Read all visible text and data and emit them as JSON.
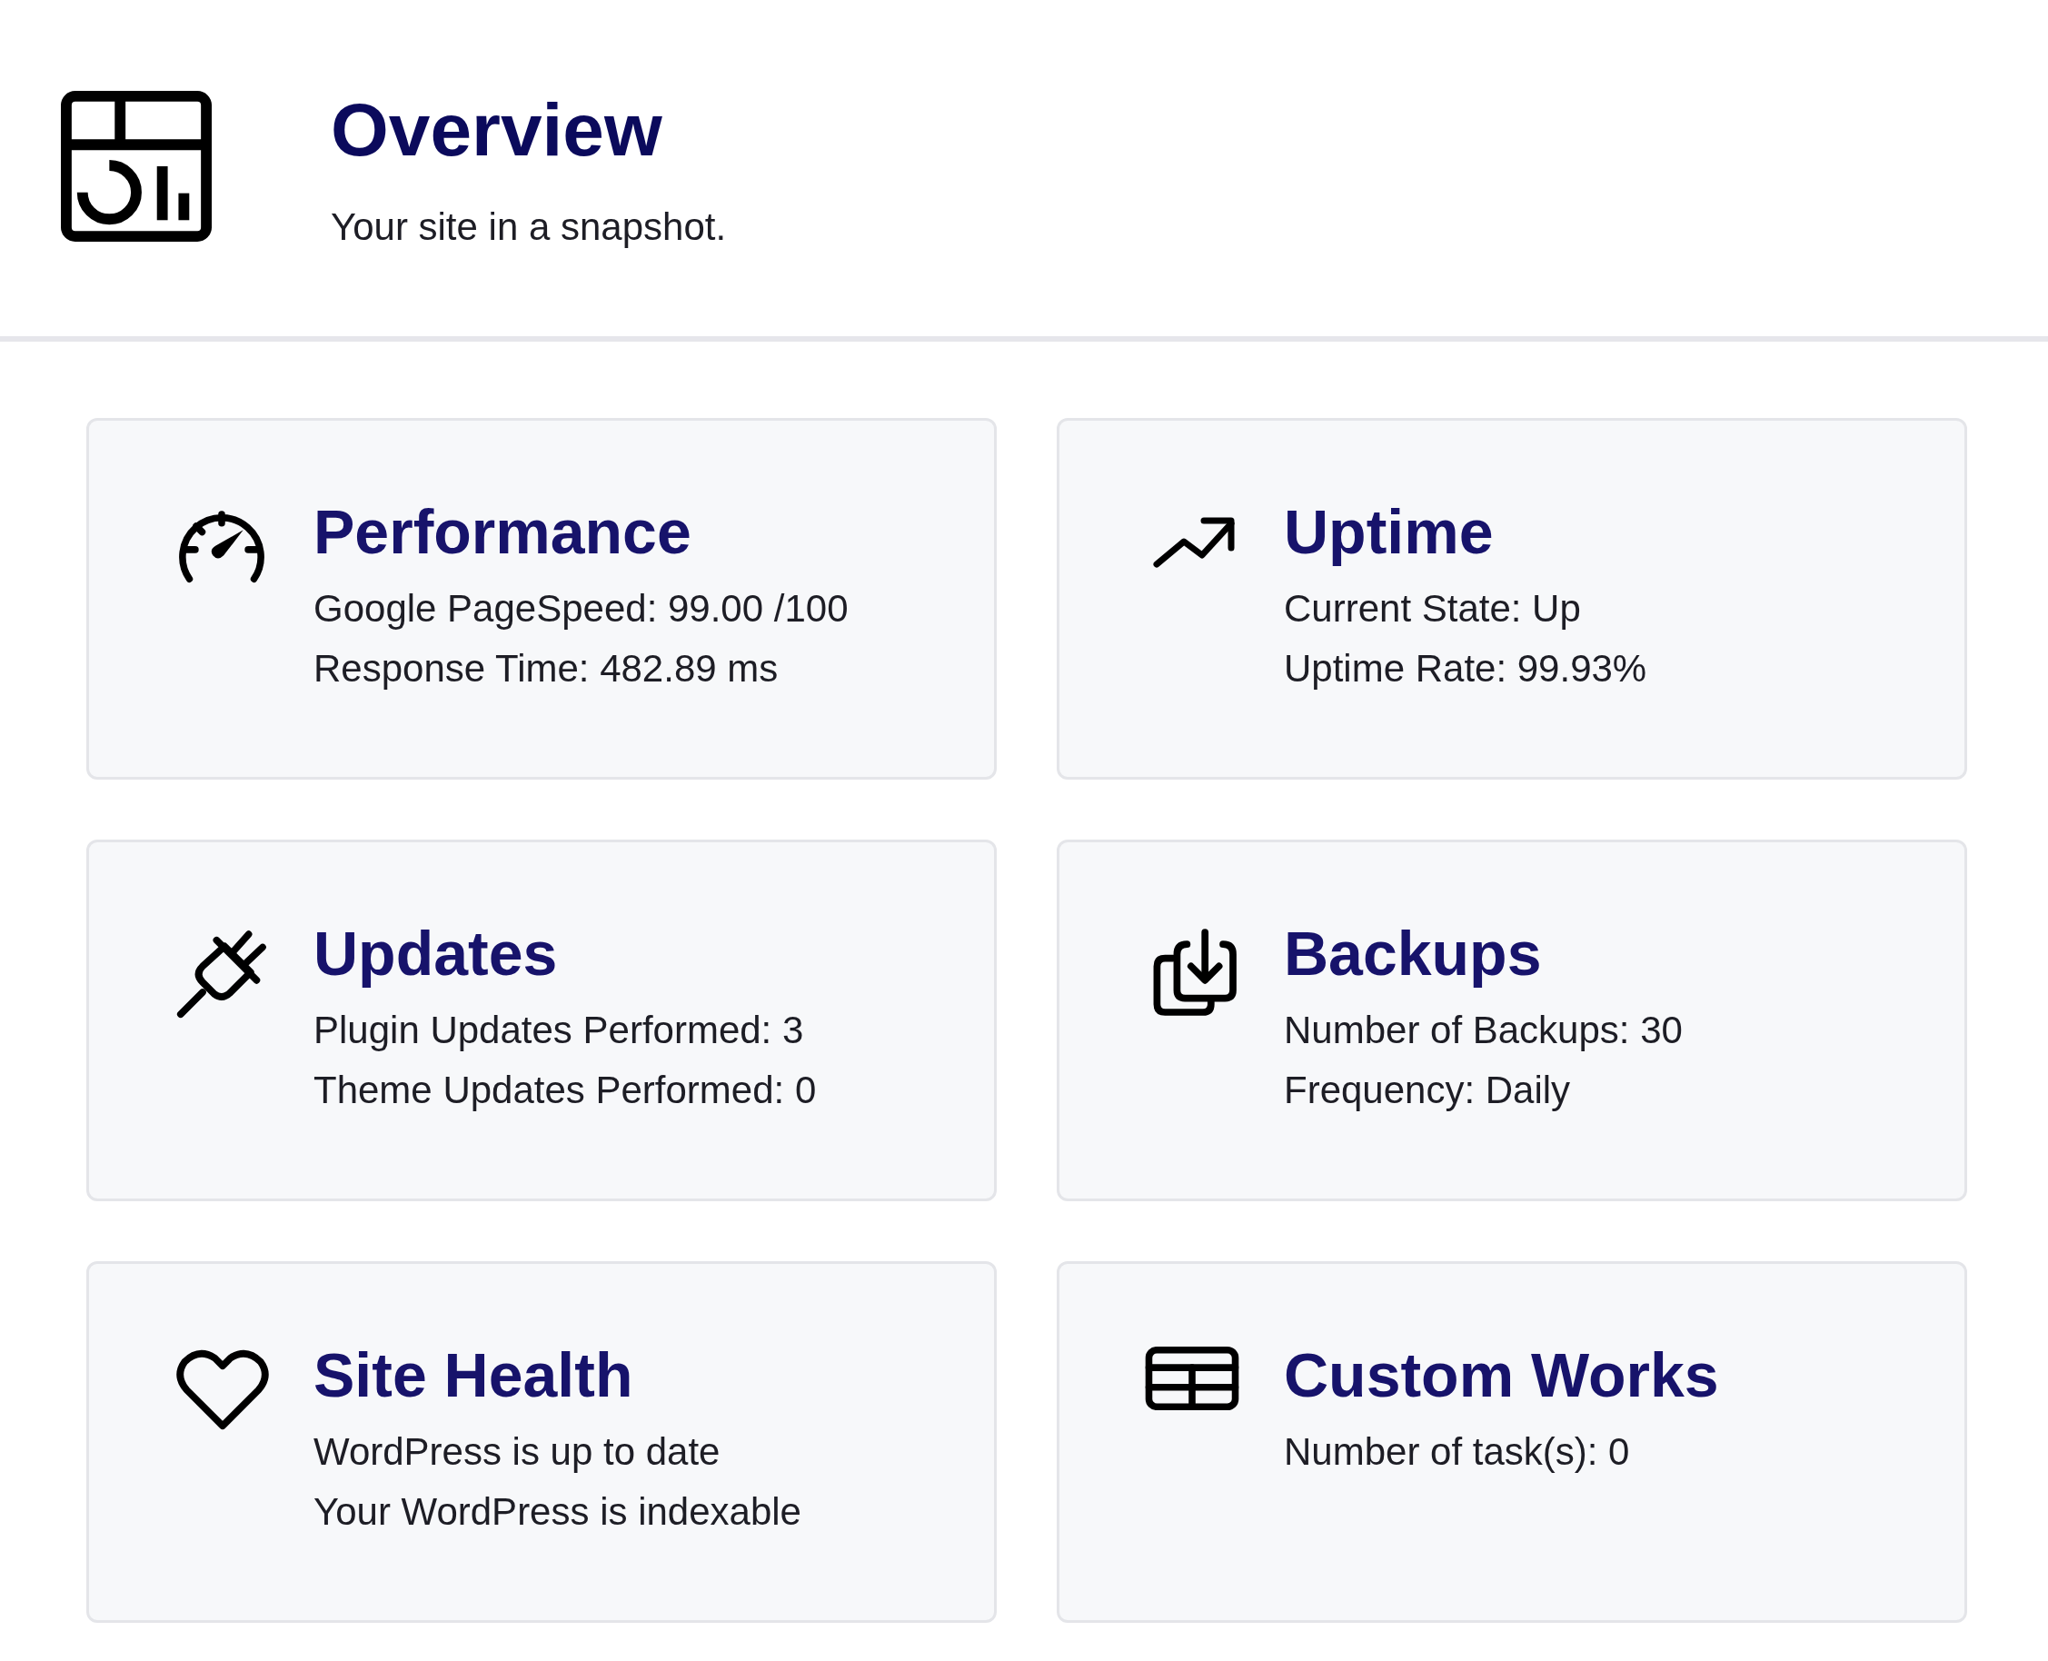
{
  "header": {
    "title": "Overview",
    "subtitle": "Your site in a snapshot."
  },
  "cards": [
    {
      "kind": "gauge",
      "title": "Performance",
      "lines": [
        "Google PageSpeed: 99.00 /100",
        "Response Time: 482.89 ms"
      ]
    },
    {
      "kind": "trend",
      "title": "Uptime",
      "lines": [
        "Current State: Up",
        "Uptime Rate: 99.93%"
      ]
    },
    {
      "kind": "plug",
      "title": "Updates",
      "lines": [
        "Plugin Updates Performed: 3",
        "Theme Updates Performed: 0"
      ]
    },
    {
      "kind": "download",
      "title": "Backups",
      "lines": [
        "Number of Backups: 30",
        "Frequency: Daily"
      ]
    },
    {
      "kind": "heart",
      "title": "Site Health",
      "lines": [
        "WordPress is up to date",
        "Your WordPress is indexable"
      ]
    },
    {
      "kind": "table",
      "title": "Custom Works",
      "lines": [
        "Number of task(s): 0"
      ]
    }
  ]
}
